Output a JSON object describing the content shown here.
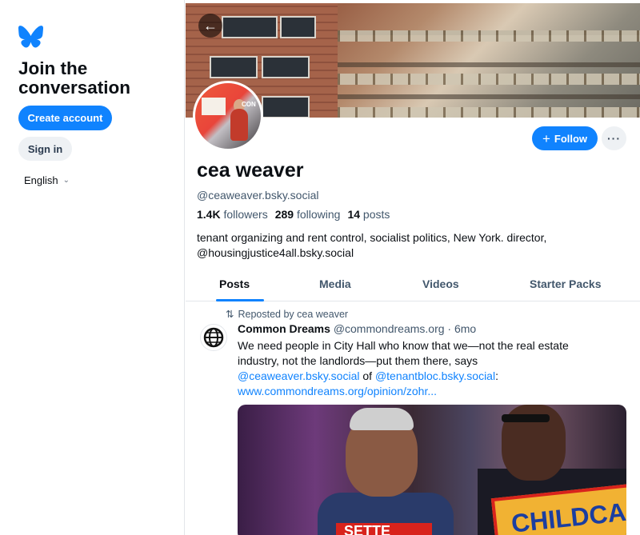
{
  "sidebar": {
    "join_title_line1": "Join the",
    "join_title_line2": "conversation",
    "create_account_label": "Create account",
    "sign_in_label": "Sign in",
    "language": "English"
  },
  "profile": {
    "display_name": "cea weaver",
    "handle": "@ceaweaver.bsky.social",
    "followers_count": "1.4K",
    "followers_label": "followers",
    "following_count": "289",
    "following_label": "following",
    "posts_count": "14",
    "posts_label": "posts",
    "bio_line1": "tenant organizing and rent control, socialist politics, New York. director,",
    "bio_line2": "@housingjustice4all.bsky.social",
    "follow_label": "Follow",
    "avatar_sign_text": "CON"
  },
  "tabs": [
    "Posts",
    "Media",
    "Videos",
    "Starter Packs"
  ],
  "post": {
    "repost_label": "Reposted by cea weaver",
    "author_name": "Common Dreams",
    "author_handle": "@commondreams.org",
    "time": "· 6mo",
    "text_line1": "We need people in City Hall who know that we—not the real estate",
    "text_line2": "industry, not the landlords—put them there, says",
    "mention1": "@ceaweaver.bsky.social",
    "of_word": " of ",
    "mention2": "@tenantbloc.bsky.social",
    "colon": ":",
    "link": "www.commondreams.org/opinion/zohr..."
  },
  "image_text": {
    "sign_red": "SETTE",
    "sign_yellow": "CHILDCA"
  },
  "colors": {
    "accent": "#1083fe",
    "text_primary": "#0b0f14",
    "text_secondary": "#42576c"
  },
  "icons": [
    "butterfly-logo-icon",
    "chevron-down-icon",
    "back-arrow-icon",
    "plus-icon",
    "more-dots-icon",
    "repost-icon",
    "globe-icon"
  ]
}
